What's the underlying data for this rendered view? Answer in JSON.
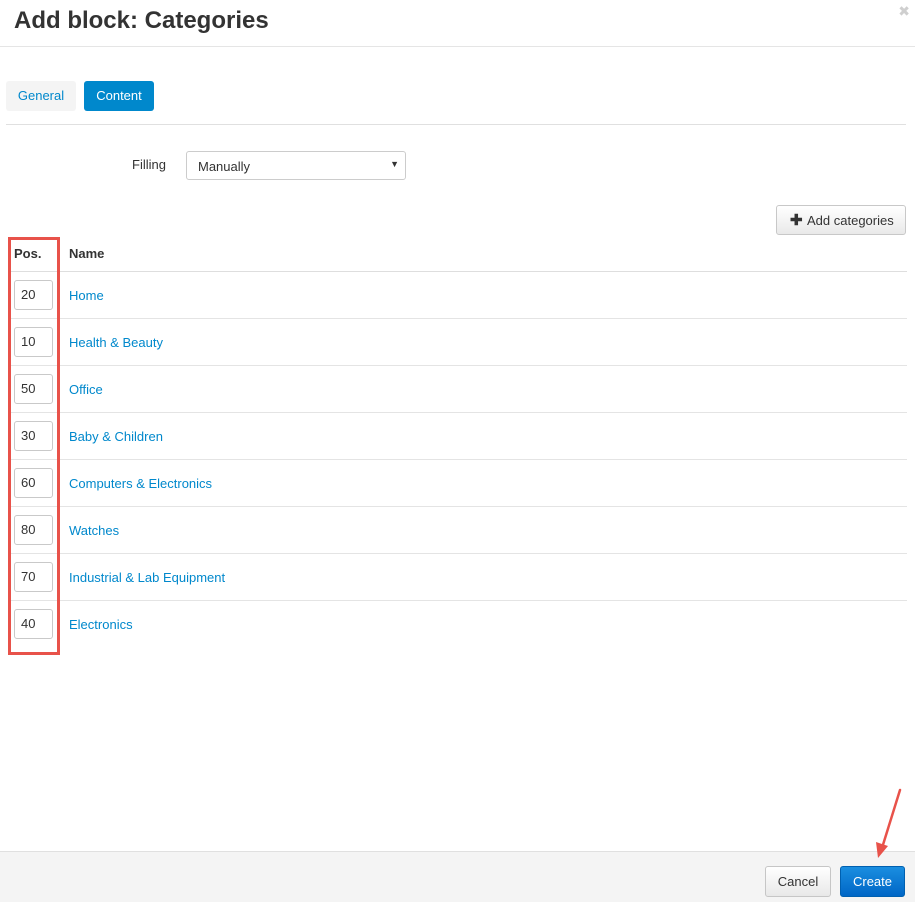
{
  "dialog": {
    "title": "Add block: Categories",
    "close_icon": "close-icon"
  },
  "tabs": [
    {
      "label": "General",
      "active": false
    },
    {
      "label": "Content",
      "active": true
    }
  ],
  "filling": {
    "label": "Filling",
    "value": "Manually"
  },
  "add_categories": {
    "icon": "plus-icon",
    "label": "Add categories"
  },
  "table": {
    "headers": {
      "pos": "Pos.",
      "name": "Name"
    },
    "rows": [
      {
        "pos": "20",
        "name": "Home"
      },
      {
        "pos": "10",
        "name": "Health & Beauty"
      },
      {
        "pos": "50",
        "name": "Office"
      },
      {
        "pos": "30",
        "name": "Baby & Children"
      },
      {
        "pos": "60",
        "name": "Computers & Electronics"
      },
      {
        "pos": "80",
        "name": "Watches"
      },
      {
        "pos": "70",
        "name": "Industrial & Lab Equipment"
      },
      {
        "pos": "40",
        "name": "Electronics"
      }
    ]
  },
  "footer": {
    "cancel_label": "Cancel",
    "create_label": "Create"
  },
  "colors": {
    "accent": "#0088cc",
    "primary_button": "#0a7ad6",
    "annotation": "#e8524a"
  }
}
